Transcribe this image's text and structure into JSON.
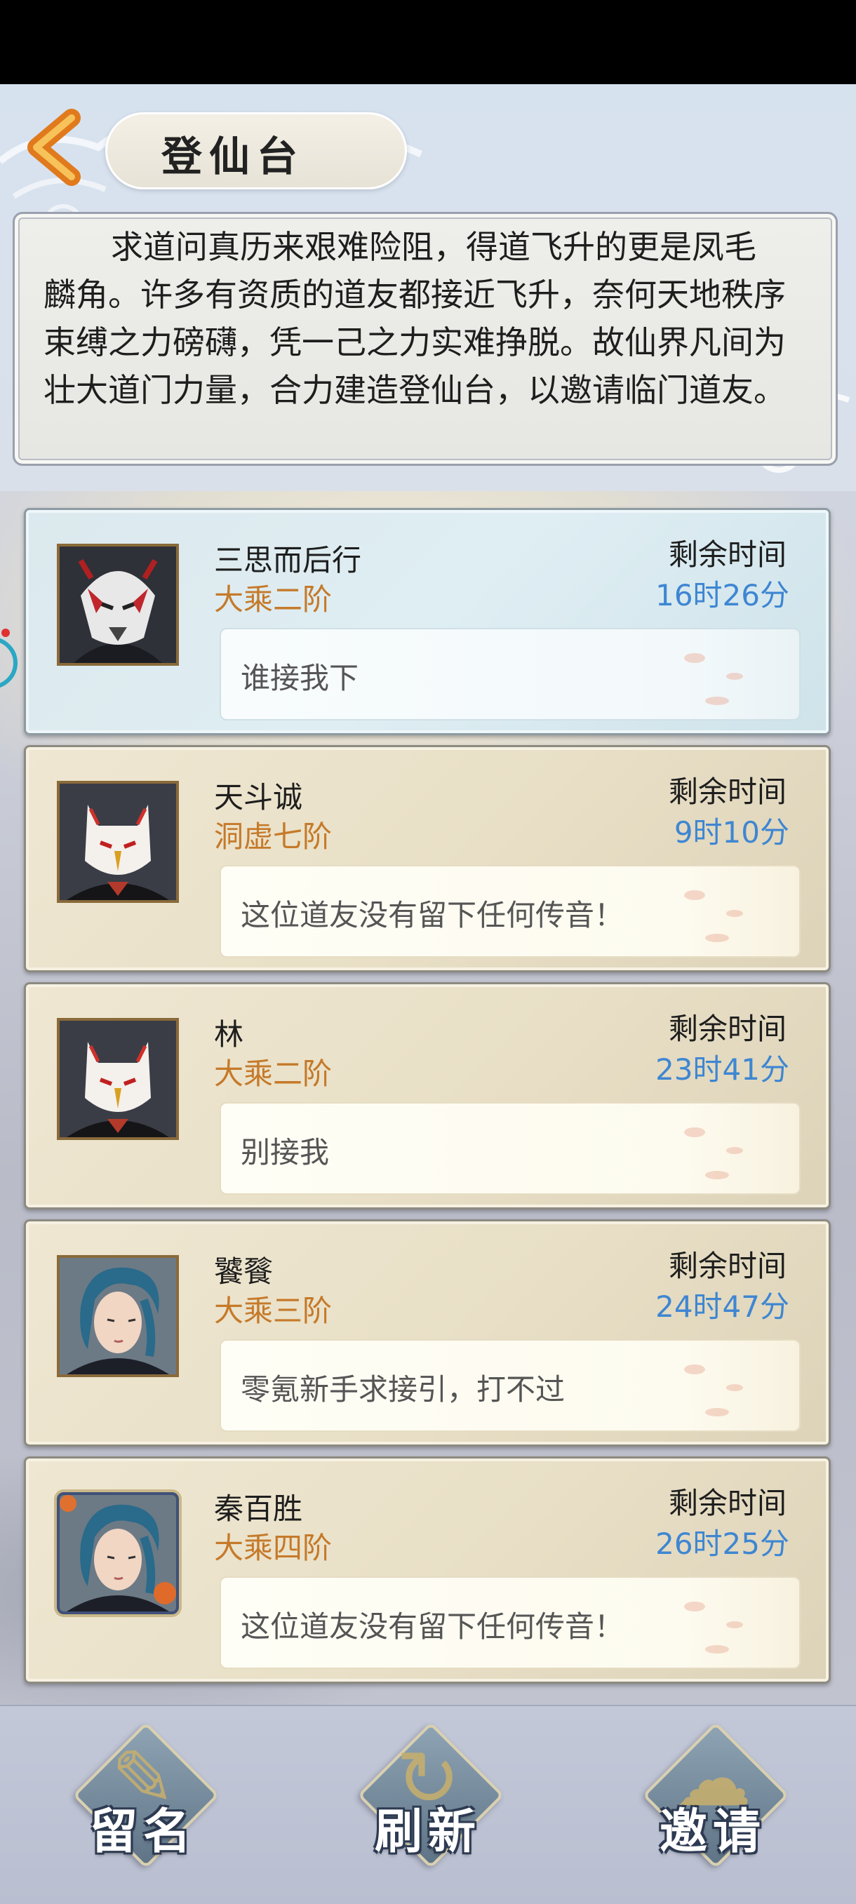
{
  "header": {
    "title": "登仙台",
    "intro": "求道问真历来艰难险阻，得道飞升的更是凤毛麟角。许多有资质的道友都接近飞升，奈何天地秩序束缚之力磅礴，凭一己之力实难挣脱。故仙界凡间为壮大道门力量，合力建造登仙台，以邀请临门道友。"
  },
  "time_label": "剩余时间",
  "cards": [
    {
      "name": "三思而后行",
      "rank": "大乘二阶",
      "time": "16时26分",
      "message": "谁接我下",
      "highlighted": true,
      "avatar": "red-white-mask"
    },
    {
      "name": "天斗诚",
      "rank": "洞虚七阶",
      "time": "9时10分",
      "message": "这位道友没有留下任何传音！",
      "highlighted": false,
      "avatar": "fox-mask"
    },
    {
      "name": "林",
      "rank": "大乘二阶",
      "time": "23时41分",
      "message": "别接我",
      "highlighted": false,
      "avatar": "fox-mask"
    },
    {
      "name": "饕餮",
      "rank": "大乘三阶",
      "time": "24时47分",
      "message": "零氪新手求接引，打不过",
      "highlighted": false,
      "avatar": "blue-hair"
    },
    {
      "name": "秦百胜",
      "rank": "大乘四阶",
      "time": "26时25分",
      "message": "这位道友没有留下任何传音！",
      "highlighted": false,
      "avatar": "blue-hair-framed"
    }
  ],
  "actions": {
    "leave_name": "留名",
    "refresh": "刷新",
    "invite": "邀请"
  },
  "colors": {
    "rank": "#c57a2a",
    "time": "#3e86d2"
  }
}
